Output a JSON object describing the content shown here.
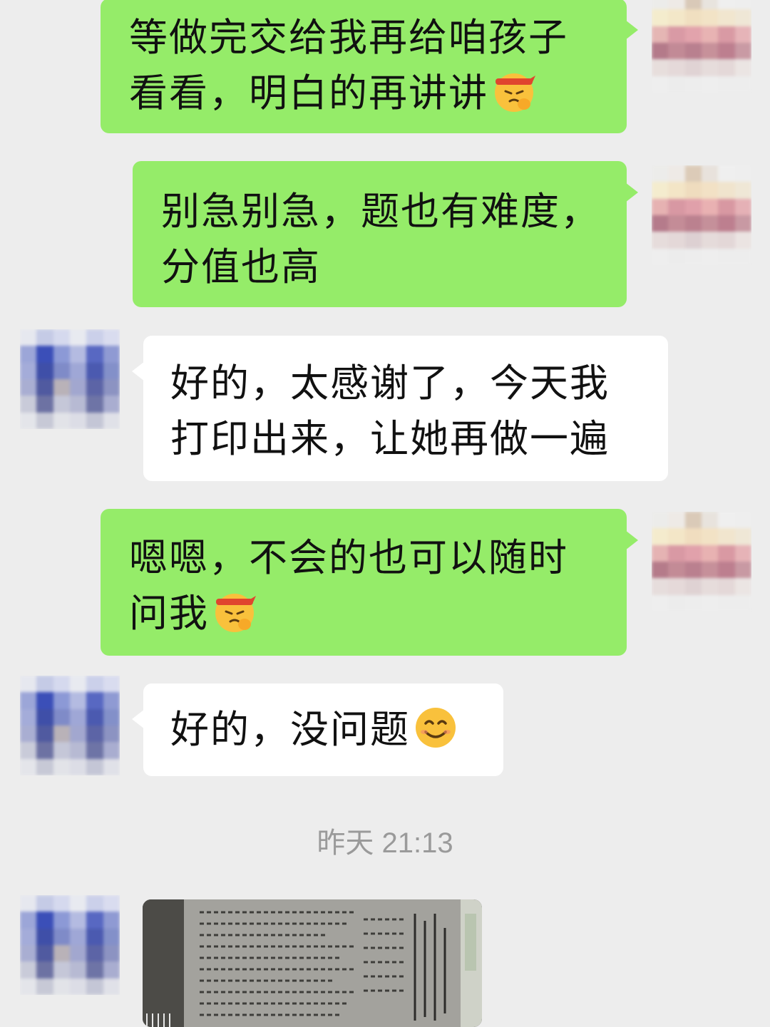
{
  "messages": [
    {
      "sender": "me",
      "lines": [
        "等做完交给我再给咱孩子",
        "看看，明白的再讲讲"
      ],
      "emoji": "salute-face-emoji"
    },
    {
      "sender": "me",
      "lines": [
        "别急别急，题也有难度，",
        "分值也高"
      ]
    },
    {
      "sender": "other",
      "lines": [
        "好的，太感谢了，今天我",
        "打印出来，让她再做一遍"
      ]
    },
    {
      "sender": "me",
      "lines": [
        "嗯嗯，不会的也可以随时",
        "问我"
      ],
      "emoji": "salute-face-emoji"
    },
    {
      "sender": "other",
      "lines": [
        "好的，没问题"
      ],
      "emoji": "smile-emoji"
    }
  ],
  "timestamp": "昨天 21:13",
  "image_message": {
    "sender": "other",
    "content": "photo-of-printed-worksheet"
  },
  "colors": {
    "background": "#ededed",
    "my_bubble": "#95ec69",
    "other_bubble": "#ffffff",
    "timestamp_text": "#9a9a9a"
  }
}
